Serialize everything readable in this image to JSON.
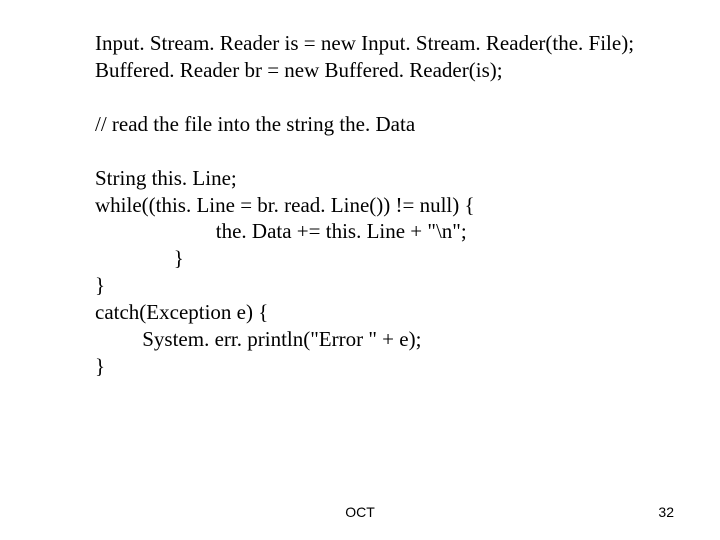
{
  "code": {
    "l1": "Input. Stream. Reader is = new Input. Stream. Reader(the. File);",
    "l2": "Buffered. Reader br = new Buffered. Reader(is);",
    "l3": "// read the file into the string the. Data",
    "l4": "String this. Line;",
    "l5": "while((this. Line = br. read. Line()) != null) {",
    "l6": "                       the. Data += this. Line + \"\\n\";",
    "l7": "               }",
    "l8": "}",
    "l9": "catch(Exception e) {",
    "l10": "         System. err. println(\"Error \" + e);",
    "l11": "}"
  },
  "footer": {
    "label": "OCT",
    "page": "32"
  }
}
